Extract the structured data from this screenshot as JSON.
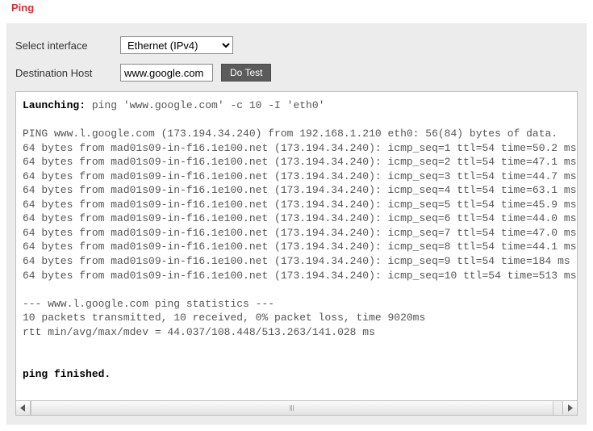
{
  "title": "Ping",
  "form": {
    "interface_label": "Select interface",
    "interface_value": "Ethernet (IPv4)",
    "host_label": "Destination Host",
    "host_value": "www.google.com",
    "button": "Do Test"
  },
  "output": {
    "launch_label": "Launching:",
    "launch_cmd": " ping 'www.google.com' -c 10 -I 'eth0'",
    "header": "PING www.l.google.com (173.194.34.240) from 192.168.1.210 eth0: 56(84) bytes of data.",
    "lines": [
      "64 bytes from mad01s09-in-f16.1e100.net (173.194.34.240): icmp_seq=1 ttl=54 time=50.2 ms",
      "64 bytes from mad01s09-in-f16.1e100.net (173.194.34.240): icmp_seq=2 ttl=54 time=47.1 ms",
      "64 bytes from mad01s09-in-f16.1e100.net (173.194.34.240): icmp_seq=3 ttl=54 time=44.7 ms",
      "64 bytes from mad01s09-in-f16.1e100.net (173.194.34.240): icmp_seq=4 ttl=54 time=63.1 ms",
      "64 bytes from mad01s09-in-f16.1e100.net (173.194.34.240): icmp_seq=5 ttl=54 time=45.9 ms",
      "64 bytes from mad01s09-in-f16.1e100.net (173.194.34.240): icmp_seq=6 ttl=54 time=44.0 ms",
      "64 bytes from mad01s09-in-f16.1e100.net (173.194.34.240): icmp_seq=7 ttl=54 time=47.0 ms",
      "64 bytes from mad01s09-in-f16.1e100.net (173.194.34.240): icmp_seq=8 ttl=54 time=44.1 ms",
      "64 bytes from mad01s09-in-f16.1e100.net (173.194.34.240): icmp_seq=9 ttl=54 time=184 ms",
      "64 bytes from mad01s09-in-f16.1e100.net (173.194.34.240): icmp_seq=10 ttl=54 time=513 ms"
    ],
    "stats_sep": "--- www.l.google.com ping statistics ---",
    "stats_1": "10 packets transmitted, 10 received, 0% packet loss, time 9020ms",
    "stats_2": "rtt min/avg/max/mdev = 44.037/108.448/513.263/141.028 ms",
    "finished": "ping finished."
  }
}
